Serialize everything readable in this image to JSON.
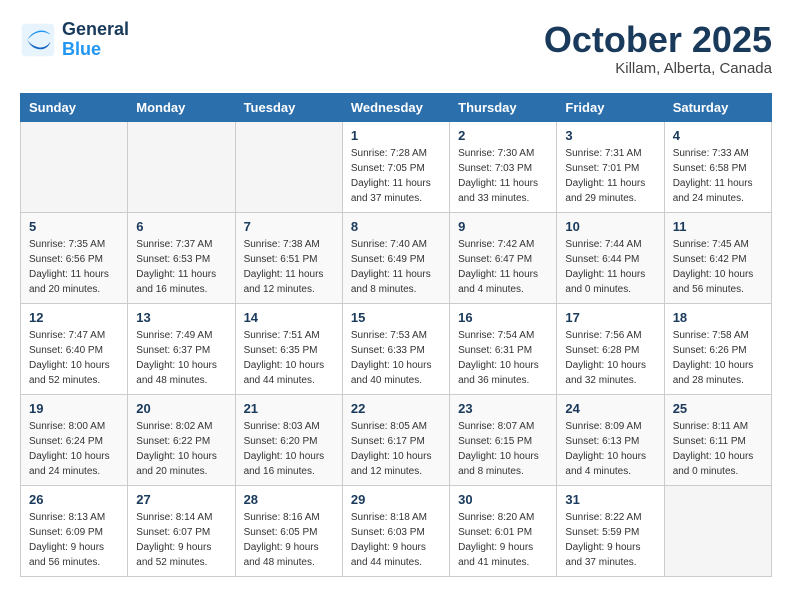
{
  "header": {
    "logo_line1": "General",
    "logo_line2": "Blue",
    "month": "October 2025",
    "location": "Killam, Alberta, Canada"
  },
  "weekdays": [
    "Sunday",
    "Monday",
    "Tuesday",
    "Wednesday",
    "Thursday",
    "Friday",
    "Saturday"
  ],
  "weeks": [
    [
      {
        "day": "",
        "sunrise": "",
        "sunset": "",
        "daylight": ""
      },
      {
        "day": "",
        "sunrise": "",
        "sunset": "",
        "daylight": ""
      },
      {
        "day": "",
        "sunrise": "",
        "sunset": "",
        "daylight": ""
      },
      {
        "day": "1",
        "sunrise": "Sunrise: 7:28 AM",
        "sunset": "Sunset: 7:05 PM",
        "daylight": "Daylight: 11 hours and 37 minutes."
      },
      {
        "day": "2",
        "sunrise": "Sunrise: 7:30 AM",
        "sunset": "Sunset: 7:03 PM",
        "daylight": "Daylight: 11 hours and 33 minutes."
      },
      {
        "day": "3",
        "sunrise": "Sunrise: 7:31 AM",
        "sunset": "Sunset: 7:01 PM",
        "daylight": "Daylight: 11 hours and 29 minutes."
      },
      {
        "day": "4",
        "sunrise": "Sunrise: 7:33 AM",
        "sunset": "Sunset: 6:58 PM",
        "daylight": "Daylight: 11 hours and 24 minutes."
      }
    ],
    [
      {
        "day": "5",
        "sunrise": "Sunrise: 7:35 AM",
        "sunset": "Sunset: 6:56 PM",
        "daylight": "Daylight: 11 hours and 20 minutes."
      },
      {
        "day": "6",
        "sunrise": "Sunrise: 7:37 AM",
        "sunset": "Sunset: 6:53 PM",
        "daylight": "Daylight: 11 hours and 16 minutes."
      },
      {
        "day": "7",
        "sunrise": "Sunrise: 7:38 AM",
        "sunset": "Sunset: 6:51 PM",
        "daylight": "Daylight: 11 hours and 12 minutes."
      },
      {
        "day": "8",
        "sunrise": "Sunrise: 7:40 AM",
        "sunset": "Sunset: 6:49 PM",
        "daylight": "Daylight: 11 hours and 8 minutes."
      },
      {
        "day": "9",
        "sunrise": "Sunrise: 7:42 AM",
        "sunset": "Sunset: 6:47 PM",
        "daylight": "Daylight: 11 hours and 4 minutes."
      },
      {
        "day": "10",
        "sunrise": "Sunrise: 7:44 AM",
        "sunset": "Sunset: 6:44 PM",
        "daylight": "Daylight: 11 hours and 0 minutes."
      },
      {
        "day": "11",
        "sunrise": "Sunrise: 7:45 AM",
        "sunset": "Sunset: 6:42 PM",
        "daylight": "Daylight: 10 hours and 56 minutes."
      }
    ],
    [
      {
        "day": "12",
        "sunrise": "Sunrise: 7:47 AM",
        "sunset": "Sunset: 6:40 PM",
        "daylight": "Daylight: 10 hours and 52 minutes."
      },
      {
        "day": "13",
        "sunrise": "Sunrise: 7:49 AM",
        "sunset": "Sunset: 6:37 PM",
        "daylight": "Daylight: 10 hours and 48 minutes."
      },
      {
        "day": "14",
        "sunrise": "Sunrise: 7:51 AM",
        "sunset": "Sunset: 6:35 PM",
        "daylight": "Daylight: 10 hours and 44 minutes."
      },
      {
        "day": "15",
        "sunrise": "Sunrise: 7:53 AM",
        "sunset": "Sunset: 6:33 PM",
        "daylight": "Daylight: 10 hours and 40 minutes."
      },
      {
        "day": "16",
        "sunrise": "Sunrise: 7:54 AM",
        "sunset": "Sunset: 6:31 PM",
        "daylight": "Daylight: 10 hours and 36 minutes."
      },
      {
        "day": "17",
        "sunrise": "Sunrise: 7:56 AM",
        "sunset": "Sunset: 6:28 PM",
        "daylight": "Daylight: 10 hours and 32 minutes."
      },
      {
        "day": "18",
        "sunrise": "Sunrise: 7:58 AM",
        "sunset": "Sunset: 6:26 PM",
        "daylight": "Daylight: 10 hours and 28 minutes."
      }
    ],
    [
      {
        "day": "19",
        "sunrise": "Sunrise: 8:00 AM",
        "sunset": "Sunset: 6:24 PM",
        "daylight": "Daylight: 10 hours and 24 minutes."
      },
      {
        "day": "20",
        "sunrise": "Sunrise: 8:02 AM",
        "sunset": "Sunset: 6:22 PM",
        "daylight": "Daylight: 10 hours and 20 minutes."
      },
      {
        "day": "21",
        "sunrise": "Sunrise: 8:03 AM",
        "sunset": "Sunset: 6:20 PM",
        "daylight": "Daylight: 10 hours and 16 minutes."
      },
      {
        "day": "22",
        "sunrise": "Sunrise: 8:05 AM",
        "sunset": "Sunset: 6:17 PM",
        "daylight": "Daylight: 10 hours and 12 minutes."
      },
      {
        "day": "23",
        "sunrise": "Sunrise: 8:07 AM",
        "sunset": "Sunset: 6:15 PM",
        "daylight": "Daylight: 10 hours and 8 minutes."
      },
      {
        "day": "24",
        "sunrise": "Sunrise: 8:09 AM",
        "sunset": "Sunset: 6:13 PM",
        "daylight": "Daylight: 10 hours and 4 minutes."
      },
      {
        "day": "25",
        "sunrise": "Sunrise: 8:11 AM",
        "sunset": "Sunset: 6:11 PM",
        "daylight": "Daylight: 10 hours and 0 minutes."
      }
    ],
    [
      {
        "day": "26",
        "sunrise": "Sunrise: 8:13 AM",
        "sunset": "Sunset: 6:09 PM",
        "daylight": "Daylight: 9 hours and 56 minutes."
      },
      {
        "day": "27",
        "sunrise": "Sunrise: 8:14 AM",
        "sunset": "Sunset: 6:07 PM",
        "daylight": "Daylight: 9 hours and 52 minutes."
      },
      {
        "day": "28",
        "sunrise": "Sunrise: 8:16 AM",
        "sunset": "Sunset: 6:05 PM",
        "daylight": "Daylight: 9 hours and 48 minutes."
      },
      {
        "day": "29",
        "sunrise": "Sunrise: 8:18 AM",
        "sunset": "Sunset: 6:03 PM",
        "daylight": "Daylight: 9 hours and 44 minutes."
      },
      {
        "day": "30",
        "sunrise": "Sunrise: 8:20 AM",
        "sunset": "Sunset: 6:01 PM",
        "daylight": "Daylight: 9 hours and 41 minutes."
      },
      {
        "day": "31",
        "sunrise": "Sunrise: 8:22 AM",
        "sunset": "Sunset: 5:59 PM",
        "daylight": "Daylight: 9 hours and 37 minutes."
      },
      {
        "day": "",
        "sunrise": "",
        "sunset": "",
        "daylight": ""
      }
    ]
  ]
}
